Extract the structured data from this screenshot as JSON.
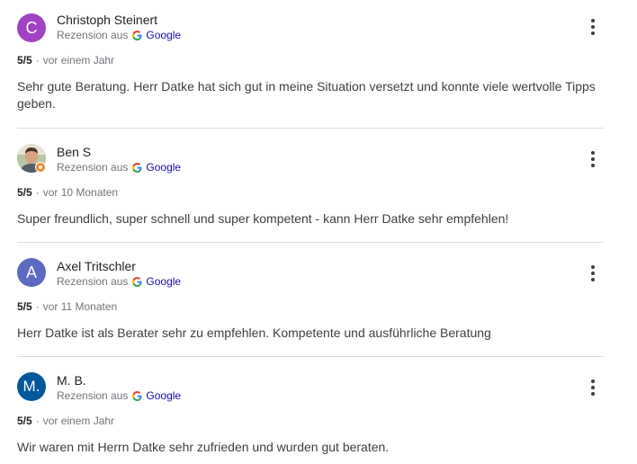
{
  "reviews": [
    {
      "name": "Christoph Steinert",
      "avatar_letter": "C",
      "avatar_color": "#a142c4",
      "source_label": "Rezension aus",
      "source_name": "Google",
      "rating": "5/5",
      "separator": "·",
      "date": "vor einem Jahr",
      "text": "Sehr gute Beratung. Herr Datke hat sich gut in meine Situation versetzt und konnte viele wertvolle Tipps geben."
    },
    {
      "name": "Ben S",
      "avatar_letter": "",
      "avatar_type": "photo",
      "local_guide": true,
      "source_label": "Rezension aus",
      "source_name": "Google",
      "rating": "5/5",
      "separator": "·",
      "date": "vor 10 Monaten",
      "text": "Super freundlich, super schnell und super kompetent - kann Herr Datke sehr empfehlen!"
    },
    {
      "name": "Axel Tritschler",
      "avatar_letter": "A",
      "avatar_color": "#5c6bc0",
      "source_label": "Rezension aus",
      "source_name": "Google",
      "rating": "5/5",
      "separator": "·",
      "date": "vor 11 Monaten",
      "text": "Herr Datke ist als Berater sehr zu empfehlen. Kompetente und ausführliche Beratung"
    },
    {
      "name": "M. B.",
      "avatar_letter": "M.",
      "avatar_color": "#01579b",
      "source_label": "Rezension aus",
      "source_name": "Google",
      "rating": "5/5",
      "separator": "·",
      "date": "vor einem Jahr",
      "text": "Wir waren mit Herrn Datke sehr zufrieden und wurden gut beraten."
    }
  ],
  "icons": {
    "more": "more-vert-icon",
    "source": "google-g-icon"
  },
  "colors": {
    "google_blue": "#4285f4",
    "google_red": "#ea4335",
    "google_yellow": "#fbbc05",
    "google_green": "#34a853",
    "link": "#1a0dab",
    "local_guide_badge": "#f28b30"
  }
}
